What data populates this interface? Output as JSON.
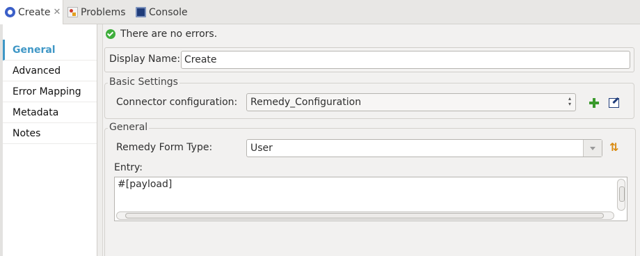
{
  "tabs": [
    {
      "label": "Create",
      "icon": "mule-connector-icon",
      "active": true,
      "closable": true
    },
    {
      "label": "Problems",
      "icon": "problems-icon",
      "active": false
    },
    {
      "label": "Console",
      "icon": "console-icon",
      "active": false
    }
  ],
  "nav": {
    "items": [
      {
        "label": "General",
        "active": true
      },
      {
        "label": "Advanced"
      },
      {
        "label": "Error Mapping"
      },
      {
        "label": "Metadata"
      },
      {
        "label": "Notes"
      }
    ]
  },
  "status": {
    "text": "There are no errors.",
    "icon": "check-circle-icon",
    "color": "#3fae3c"
  },
  "display_name": {
    "label": "Display Name:",
    "value": "Create"
  },
  "basic_settings": {
    "title": "Basic Settings",
    "connector_label": "Connector configuration:",
    "connector_value": "Remedy_Configuration",
    "add_icon": "add-icon",
    "edit_icon": "edit-icon"
  },
  "general": {
    "title": "General",
    "form_type_label": "Remedy Form Type:",
    "form_type_value": "User",
    "refresh_icon": "refresh-icon",
    "entry_label": "Entry:",
    "entry_value": "#[payload]"
  },
  "colors": {
    "accent": "#3f97c6",
    "brand": "#3b5fc8"
  }
}
